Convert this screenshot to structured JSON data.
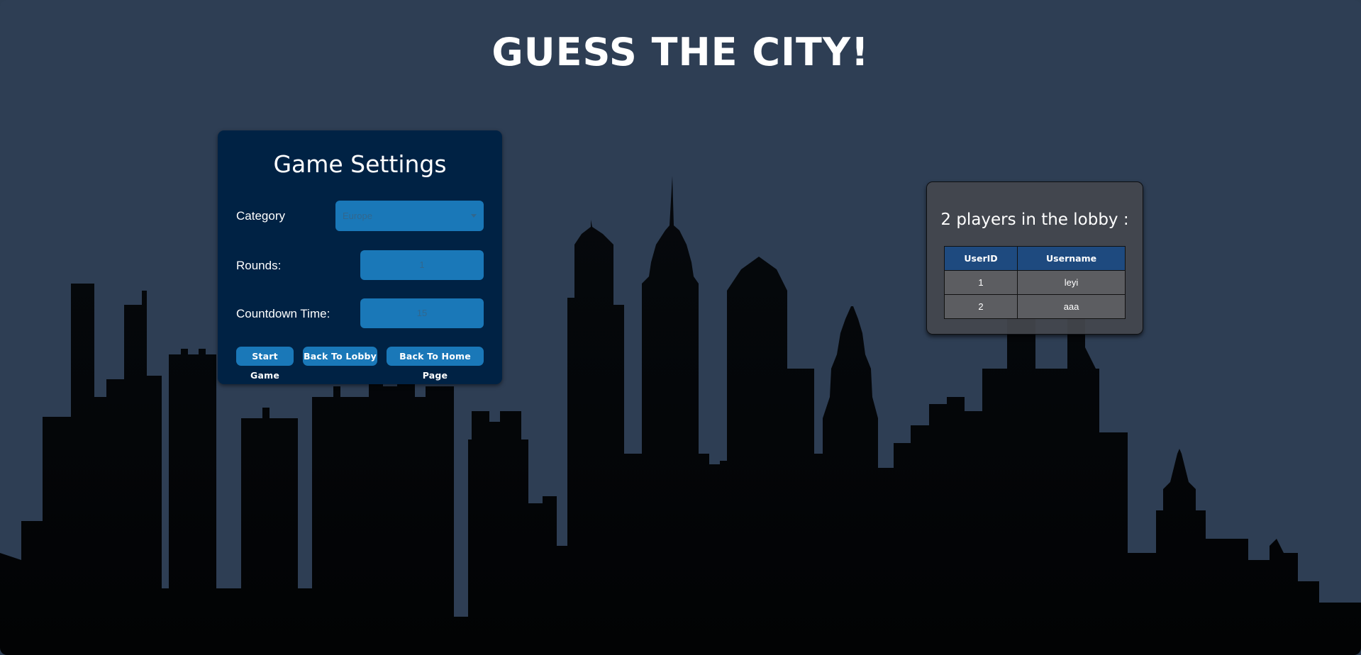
{
  "header": {
    "title": "GUESS THE CITY!"
  },
  "settings": {
    "heading": "Game Settings",
    "category_label": "Category",
    "category_value": "Europe",
    "rounds_label": "Rounds:",
    "rounds_value": "1",
    "countdown_label": "Countdown Time:",
    "countdown_value": "15",
    "buttons": {
      "start": "Start Game",
      "lobby": "Back To Lobby",
      "home": "Back To Home Page"
    }
  },
  "lobby": {
    "heading": "2 players in the lobby :",
    "columns": [
      "UserID",
      "Username"
    ],
    "rows": [
      {
        "id": "1",
        "username": "leyi"
      },
      {
        "id": "2",
        "username": "aaa"
      }
    ]
  },
  "colors": {
    "background": "#2e3e54",
    "skyline": "#040609",
    "panel": "#002244",
    "accent": "#1a78b8",
    "table_header": "#1e4a7f"
  },
  "icons": {
    "background": "city-skyline-silhouette",
    "dropdown": "caret-down-icon"
  }
}
